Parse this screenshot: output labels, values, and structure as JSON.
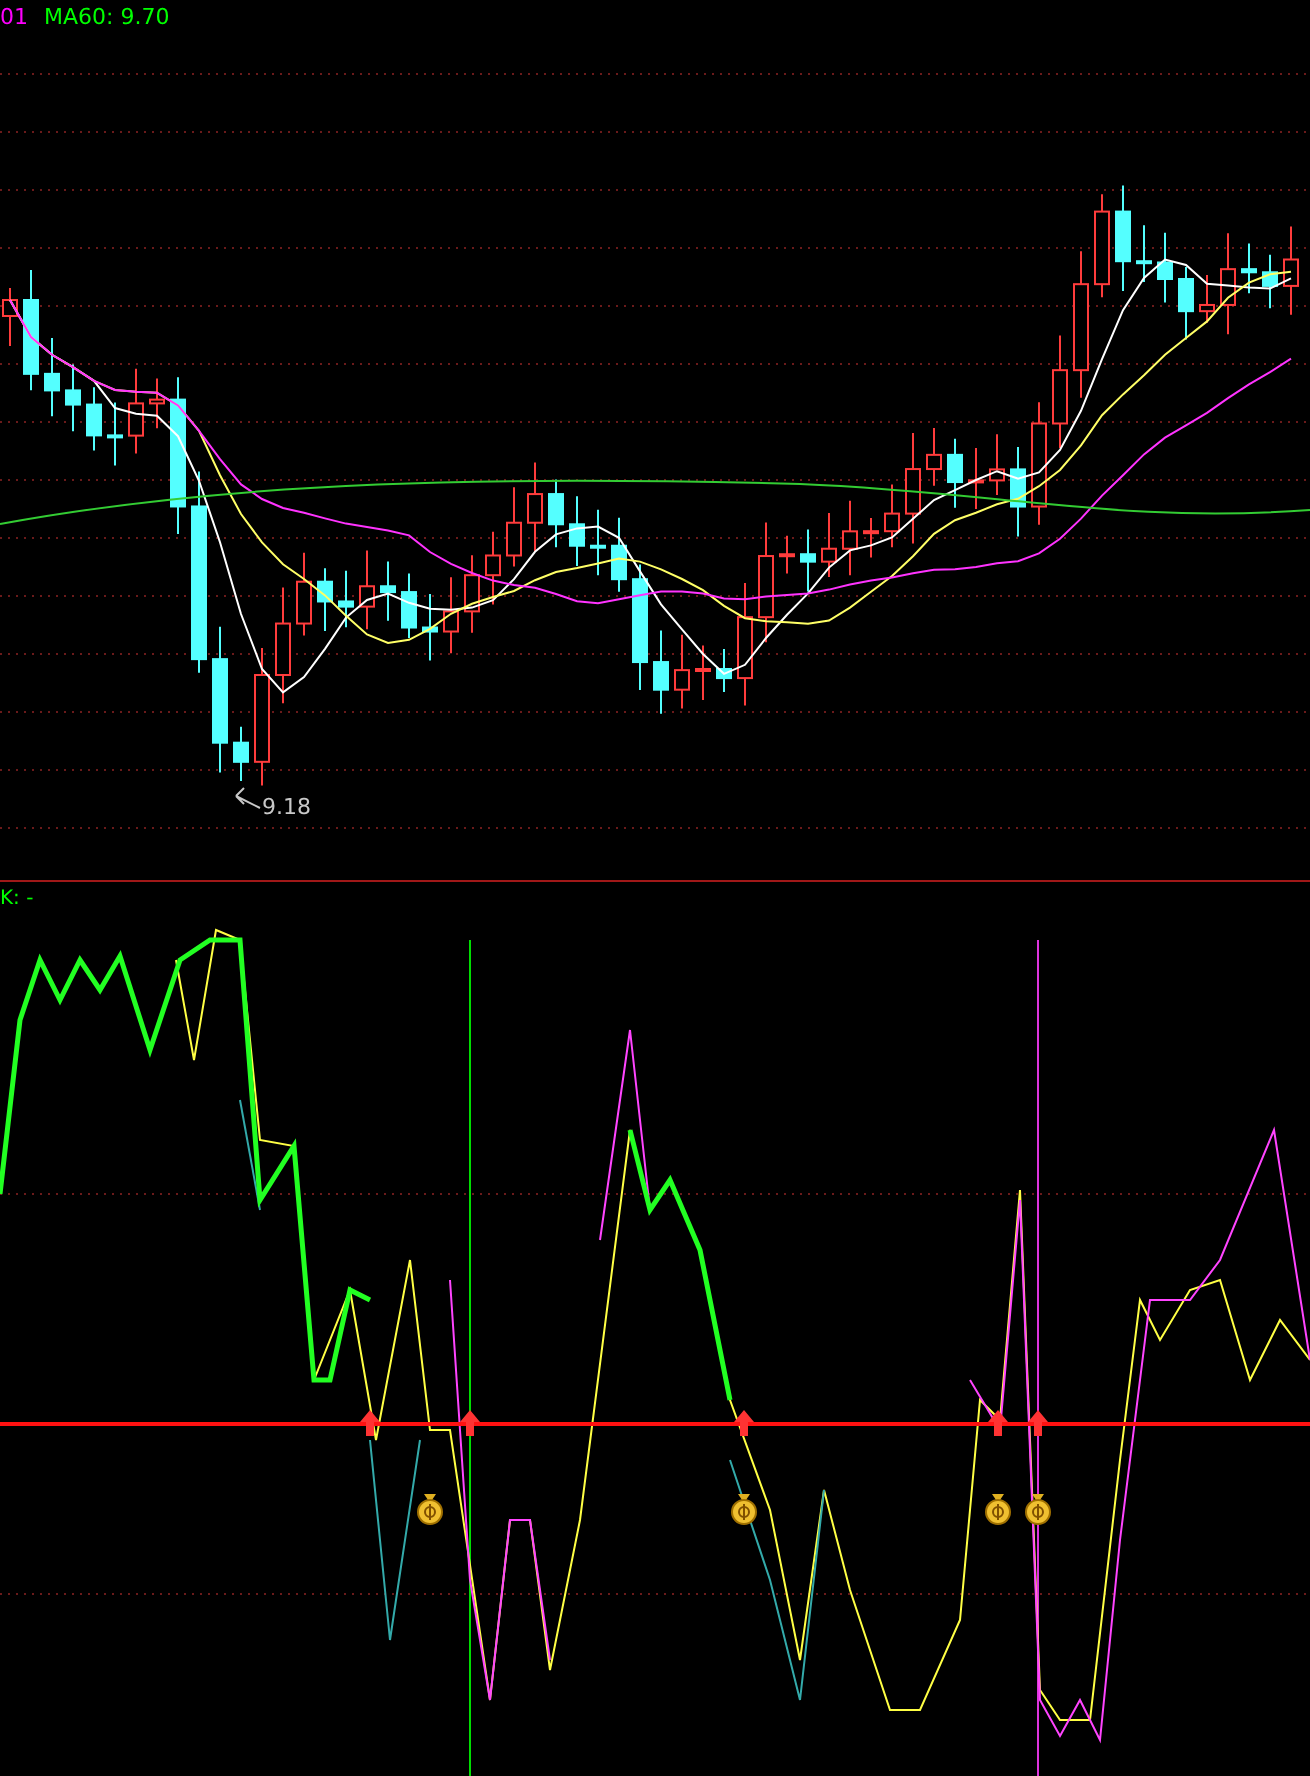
{
  "main_chart": {
    "labels": [
      {
        "text": "01",
        "color": "#ff00ff"
      },
      {
        "text": "MA60: 9.70",
        "color": "#00ff00"
      }
    ],
    "low_price_label": "9.18"
  },
  "indicator_panel": {
    "label": "K: -"
  }
}
